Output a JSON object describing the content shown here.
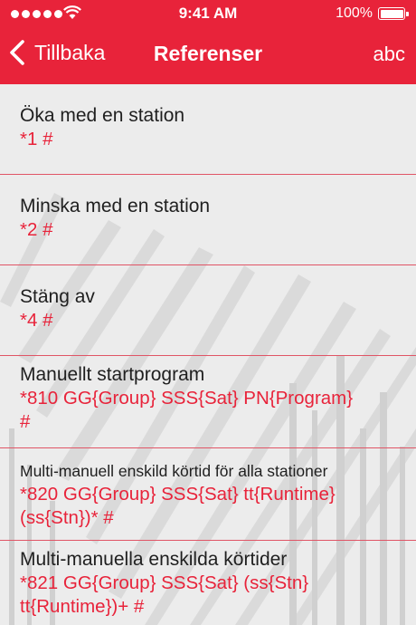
{
  "status_bar": {
    "time": "9:41 AM",
    "battery_text": "100%",
    "battery_level": 1.0
  },
  "nav": {
    "back_label": "Tillbaka",
    "title": "Referenser",
    "right_label": "abc"
  },
  "items": [
    {
      "title": "Öka med en station",
      "code": "*1 #"
    },
    {
      "title": "Minska med en station",
      "code": "*2 #"
    },
    {
      "title": "Stäng av",
      "code": "*4 #"
    },
    {
      "title": "Manuellt startprogram",
      "code_line1": "*810 GG{Group} SSS{Sat} PN{Program}",
      "code_line2": "#"
    },
    {
      "title": "Multi-manuell enskild körtid för alla stationer",
      "code_line1": "*820 GG{Group} SSS{Sat} tt{Runtime}",
      "code_line2": "(ss{Stn})* #"
    },
    {
      "title": "Multi-manuella enskilda körtider",
      "code_line1": "*821 GG{Group} SSS{Sat} (ss{Stn}",
      "code_line2": "tt{Runtime})+ #"
    }
  ],
  "colors": {
    "accent": "#e8233a",
    "background": "#ececec",
    "text": "#1f1f1f"
  },
  "icons": [
    "signal-icon",
    "wifi-icon",
    "battery-icon",
    "chevron-left-icon"
  ]
}
